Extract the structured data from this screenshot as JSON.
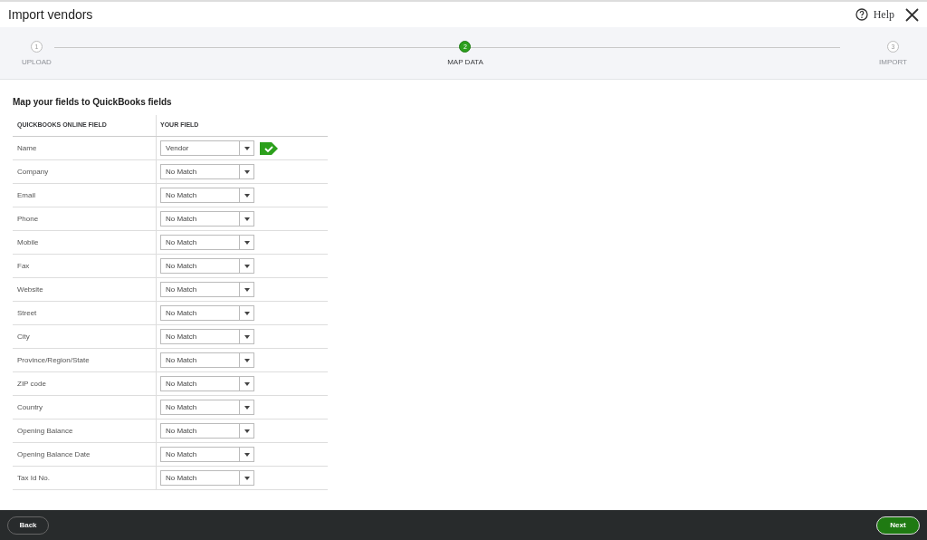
{
  "window": {
    "title": "Import vendors",
    "help": "Help"
  },
  "steps": [
    {
      "number": "1",
      "label": "UPLOAD",
      "selected": false
    },
    {
      "number": "2",
      "label": "MAP DATA",
      "selected": true
    },
    {
      "number": "3",
      "label": "IMPORT",
      "selected": false
    }
  ],
  "mapping": {
    "heading": "Map your fields to QuickBooks fields",
    "columns": [
      "QUICKBOOKS ONLINE FIELD",
      "YOUR FIELD"
    ],
    "rows": [
      {
        "field": "Name",
        "value": "Vendor",
        "matched": true
      },
      {
        "field": "Company",
        "value": "No Match",
        "matched": false
      },
      {
        "field": "Email",
        "value": "No Match",
        "matched": false
      },
      {
        "field": "Phone",
        "value": "No Match",
        "matched": false
      },
      {
        "field": "Mobile",
        "value": "No Match",
        "matched": false
      },
      {
        "field": "Fax",
        "value": "No Match",
        "matched": false
      },
      {
        "field": "Website",
        "value": "No Match",
        "matched": false
      },
      {
        "field": "Street",
        "value": "No Match",
        "matched": false
      },
      {
        "field": "City",
        "value": "No Match",
        "matched": false
      },
      {
        "field": "Province/Region/State",
        "value": "No Match",
        "matched": false
      },
      {
        "field": "ZIP code",
        "value": "No Match",
        "matched": false
      },
      {
        "field": "Country",
        "value": "No Match",
        "matched": false
      },
      {
        "field": "Opening Balance",
        "value": "No Match",
        "matched": false
      },
      {
        "field": "Opening Balance Date",
        "value": "No Match",
        "matched": false
      },
      {
        "field": "Tax Id No.",
        "value": "No Match",
        "matched": false
      }
    ]
  },
  "footer": {
    "back": "Back",
    "next": "Next"
  }
}
